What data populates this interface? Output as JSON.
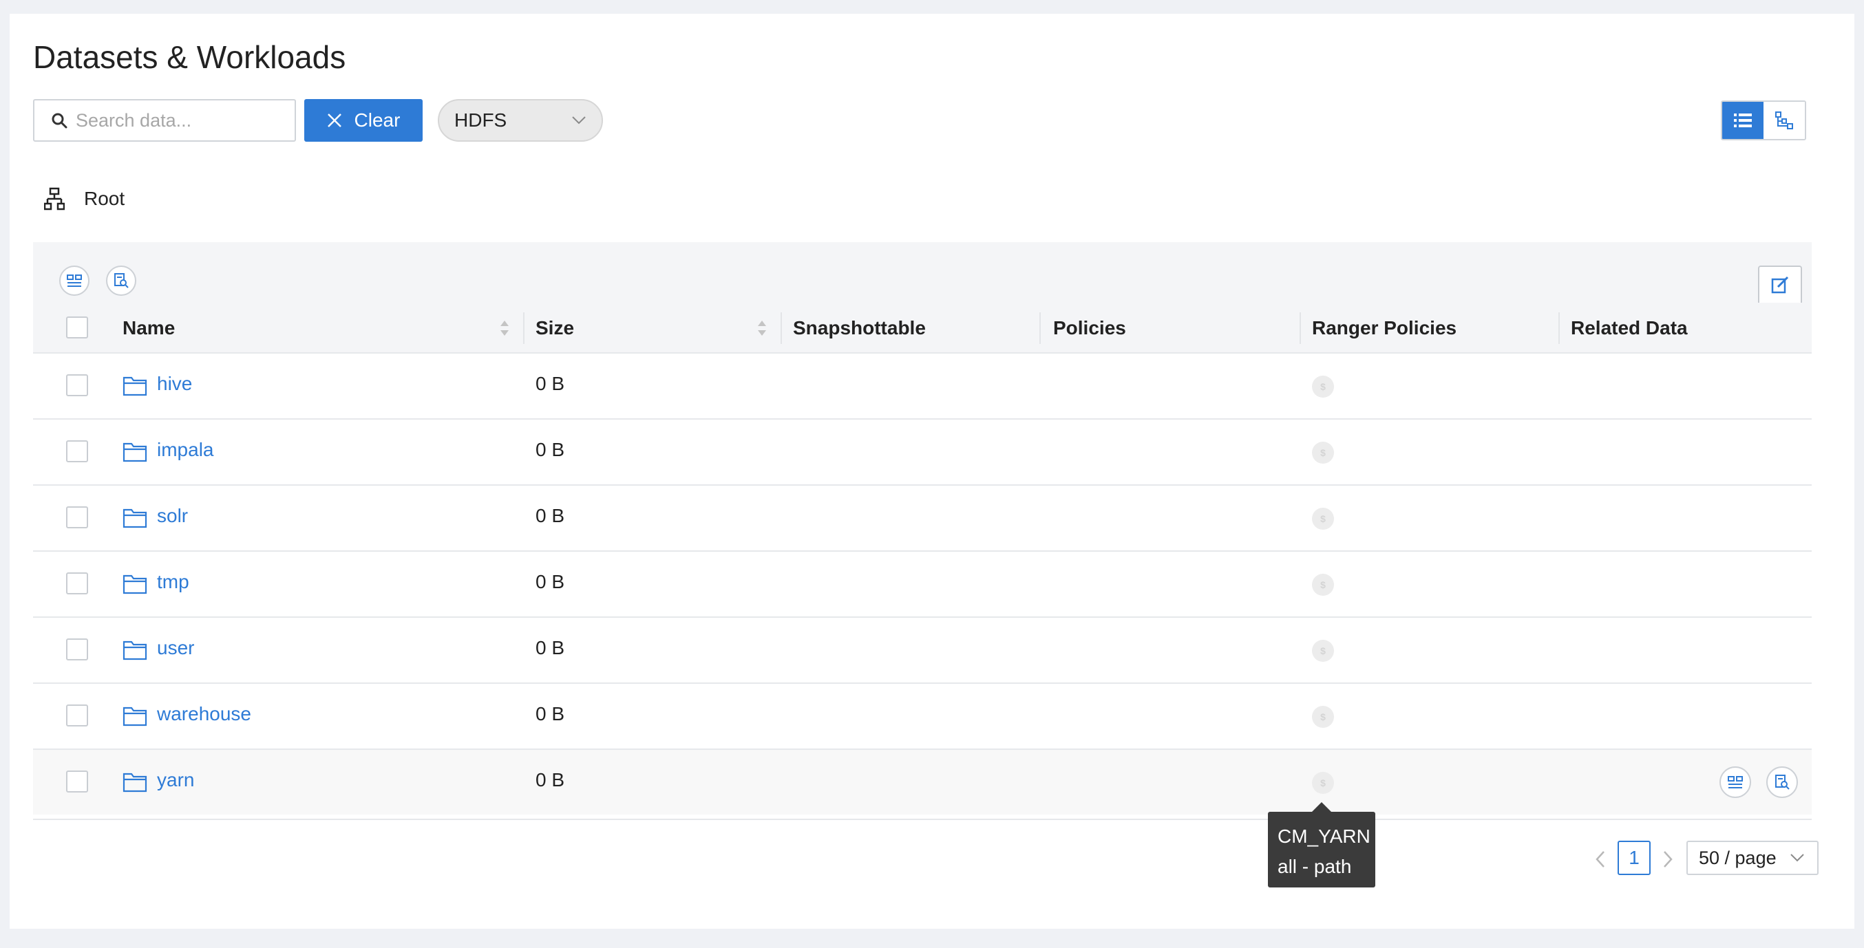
{
  "page": {
    "title": "Datasets & Workloads"
  },
  "toolbar": {
    "search_placeholder": "Search data...",
    "clear_label": "Clear",
    "source_select": "HDFS"
  },
  "breadcrumb": {
    "root": "Root"
  },
  "table": {
    "columns": {
      "name": "Name",
      "size": "Size",
      "snapshottable": "Snapshottable",
      "policies": "Policies",
      "ranger_policies": "Ranger Policies",
      "related_data": "Related Data"
    },
    "rows": [
      {
        "name": "hive",
        "size": "0 B"
      },
      {
        "name": "impala",
        "size": "0 B"
      },
      {
        "name": "solr",
        "size": "0 B"
      },
      {
        "name": "tmp",
        "size": "0 B"
      },
      {
        "name": "user",
        "size": "0 B"
      },
      {
        "name": "warehouse",
        "size": "0 B"
      },
      {
        "name": "yarn",
        "size": "0 B"
      }
    ]
  },
  "tooltip": {
    "line1": "CM_YARN",
    "line2": "all - path"
  },
  "pagination": {
    "current_page": "1",
    "page_size": "50 / page"
  },
  "colors": {
    "accent": "#2e7bd6",
    "tooltip_bg": "#3b3b3b"
  },
  "icons": {
    "search": "search-icon",
    "clear": "close-icon",
    "select": "chevron-down-icon",
    "list_view": "list-view-icon",
    "tree_view": "tree-view-icon",
    "root": "hierarchy-icon",
    "folder": "folder-icon",
    "edit": "edit-icon"
  }
}
